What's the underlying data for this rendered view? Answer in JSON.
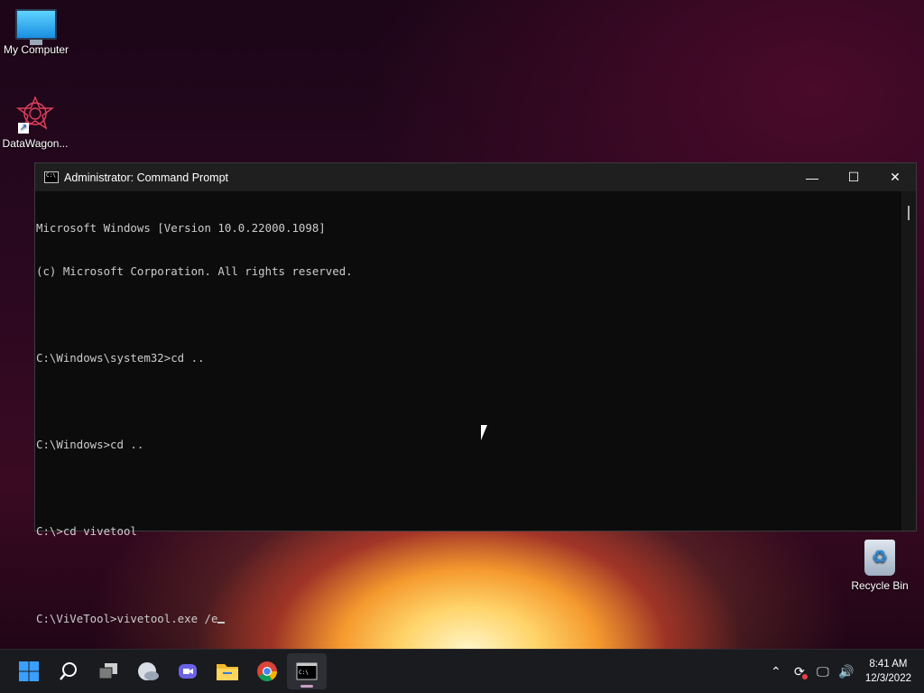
{
  "desktop": {
    "icons": [
      {
        "label": "My Computer",
        "icon": "monitor-icon"
      },
      {
        "label": "DataWagon...",
        "icon": "datawagon-icon"
      },
      {
        "label": "Recycle Bin",
        "icon": "recycle-bin-icon"
      }
    ]
  },
  "window": {
    "title": "Administrator: Command Prompt",
    "controls": {
      "minimize": "—",
      "maximize": "☐",
      "close": "✕"
    },
    "lines": [
      "Microsoft Windows [Version 10.0.22000.1098]",
      "(c) Microsoft Corporation. All rights reserved.",
      "",
      "C:\\Windows\\system32>cd ..",
      "",
      "C:\\Windows>cd ..",
      "",
      "C:\\>cd vivetool",
      "",
      "C:\\ViVeTool>vivetool.exe /e"
    ]
  },
  "taskbar": {
    "apps": [
      {
        "name": "start",
        "icon": "windows-icon"
      },
      {
        "name": "search",
        "icon": "search-icon"
      },
      {
        "name": "task-view",
        "icon": "task-view-icon"
      },
      {
        "name": "widgets",
        "icon": "weather-icon"
      },
      {
        "name": "chat",
        "icon": "chat-icon"
      },
      {
        "name": "file-explorer",
        "icon": "folder-icon"
      },
      {
        "name": "chrome",
        "icon": "chrome-icon"
      },
      {
        "name": "command-prompt",
        "icon": "cmd-icon",
        "active": true
      }
    ],
    "tray": {
      "time": "8:41 AM",
      "date": "12/3/2022"
    }
  }
}
